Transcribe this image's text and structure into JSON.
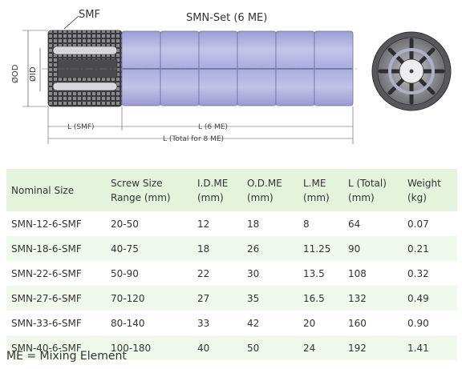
{
  "drawing": {
    "label_smf": "SMF",
    "label_set": "SMN-Set (6 ME)",
    "label_od": "ØOD",
    "label_id": "ØID",
    "dim_smf": "L (SMF)",
    "dim_6me": "L (6 ME)",
    "dim_total": "L (Total for 8 ME)"
  },
  "table": {
    "headers": [
      [
        "Nominal Size",
        ""
      ],
      [
        "Screw Size",
        "Range (mm)"
      ],
      [
        "I.D.ME",
        "(mm)"
      ],
      [
        "O.D.ME",
        "(mm)"
      ],
      [
        "L.ME",
        "(mm)"
      ],
      [
        "L (Total)",
        "(mm)"
      ],
      [
        "Weight",
        "(kg)"
      ]
    ],
    "rows": [
      [
        "SMN-12-6-SMF",
        "20-50",
        "12",
        "18",
        "8",
        "64",
        "0.07"
      ],
      [
        "SMN-18-6-SMF",
        "40-75",
        "18",
        "26",
        "11.25",
        "90",
        "0.21"
      ],
      [
        "SMN-22-6-SMF",
        "50-90",
        "22",
        "30",
        "13.5",
        "108",
        "0.32"
      ],
      [
        "SMN-27-6-SMF",
        "70-120",
        "27",
        "35",
        "16.5",
        "132",
        "0.49"
      ],
      [
        "SMN-33-6-SMF",
        "80-140",
        "33",
        "42",
        "20",
        "160",
        "0.90"
      ],
      [
        "SMN-40-6-SMF",
        "100-180",
        "40",
        "50",
        "24",
        "192",
        "1.41"
      ]
    ]
  },
  "note": "ME = Mixing Element",
  "colors": {
    "header_bg": "#e3f3dc",
    "stripe_bg": "#f1f9ed",
    "element_fill": "#b3b7e0",
    "smf_fill": "#6e6e70"
  }
}
